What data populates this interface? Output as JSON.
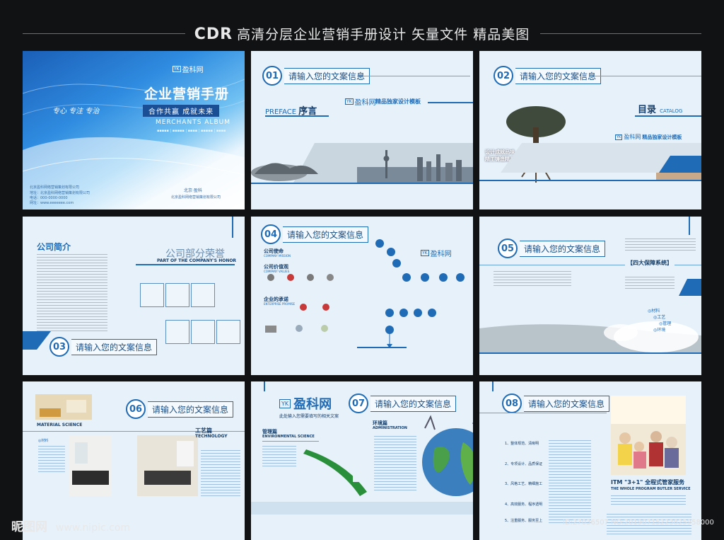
{
  "header": {
    "title_cdr": "CDR",
    "title_rest": "高清分层企业营销手册设计 矢量文件 精品美图"
  },
  "cover": {
    "logo": "盈科网",
    "logo_badge": "YK",
    "tagline": "专心 专注 专治",
    "title": "企业营销手册",
    "slogan": "合作共赢 成就未来",
    "subtitle": "MERCHANTS ALBUM",
    "left_info": "北京盈科网络营销策划有限公司",
    "contact_addr": "地址：北京盈科网络营销策划有限公司",
    "contact_phone": "电话：000-0000-0000",
    "contact_web": "网址：www.eeeeeee.com",
    "city": "北京·盈科",
    "right_info": "北京盈科网络营销策划有限公司"
  },
  "p2": {
    "num": "01",
    "label": "请输入您的文案信息",
    "preface_en": "PREFACE",
    "preface_cn": "序言",
    "logo": "盈科网",
    "logo_badge": "YK",
    "template": "精品独家设计模板"
  },
  "p3": {
    "num": "02",
    "label": "请输入您的文案信息",
    "toc_cn": "目录",
    "toc_en": "CATALOG",
    "tree_text1": "设计成就品味",
    "tree_text2": "精工铸造精品",
    "logo": "盈科网",
    "logo_badge": "YK",
    "template": "精品独家设计模板"
  },
  "p4": {
    "num": "03",
    "label": "请输入您的文案信息",
    "intro": "公司简介",
    "honor": "公司部分荣誉",
    "honor_en": "PART OF THE COMPANY'S HONOR"
  },
  "p5": {
    "num": "04",
    "label": "请输入您的文案信息",
    "mission": "公司使命",
    "mission_en": "COMPANY MISSION",
    "values": "公司价值观",
    "values_en": "COMPANY VALUES",
    "promise": "企业的承诺",
    "promise_en": "ENTERPRISE PROMISE",
    "logo": "盈科网",
    "logo_badge": "YK"
  },
  "p6": {
    "num": "05",
    "label": "请输入您的文案信息",
    "guarantee": "【四大保障系统】",
    "items": [
      "材料",
      "工艺",
      "管理",
      "环境"
    ]
  },
  "p7": {
    "num": "06",
    "label": "请输入您的文案信息",
    "material": "MATERIAL SCIENCE",
    "tech_cn": "工艺篇",
    "tech_en": "TECHNOLOGY",
    "material_cn": "材料"
  },
  "p8": {
    "num": "07",
    "label": "请输入您的文案信息",
    "logo": "盈科网",
    "logo_badge": "YK",
    "sub": "此处输入您需要填写的相关文案",
    "mgmt_cn": "管理篇",
    "mgmt_en": "ENVIRONMENTAL SCIENCE",
    "env_cn": "环境篇",
    "env_en": "ADMINISTRATION"
  },
  "p9": {
    "num": "08",
    "label": "请输入您的文案信息",
    "service": "ITM \"3+1\" 全程式管家服务",
    "service_en": "THE WHOLE PROGRAM BUTLER SERVICE",
    "items": [
      "1、整体规范、清晰明",
      "2、专项设计、品质保证",
      "3、风格工艺、精细施工",
      "4、高效服务、程序透明",
      "5、注重服务、服务至上"
    ]
  },
  "watermark": {
    "site": "昵图网",
    "url": "www.nipic.com",
    "id": "ID:27036507 NO:20190715223825958000"
  }
}
